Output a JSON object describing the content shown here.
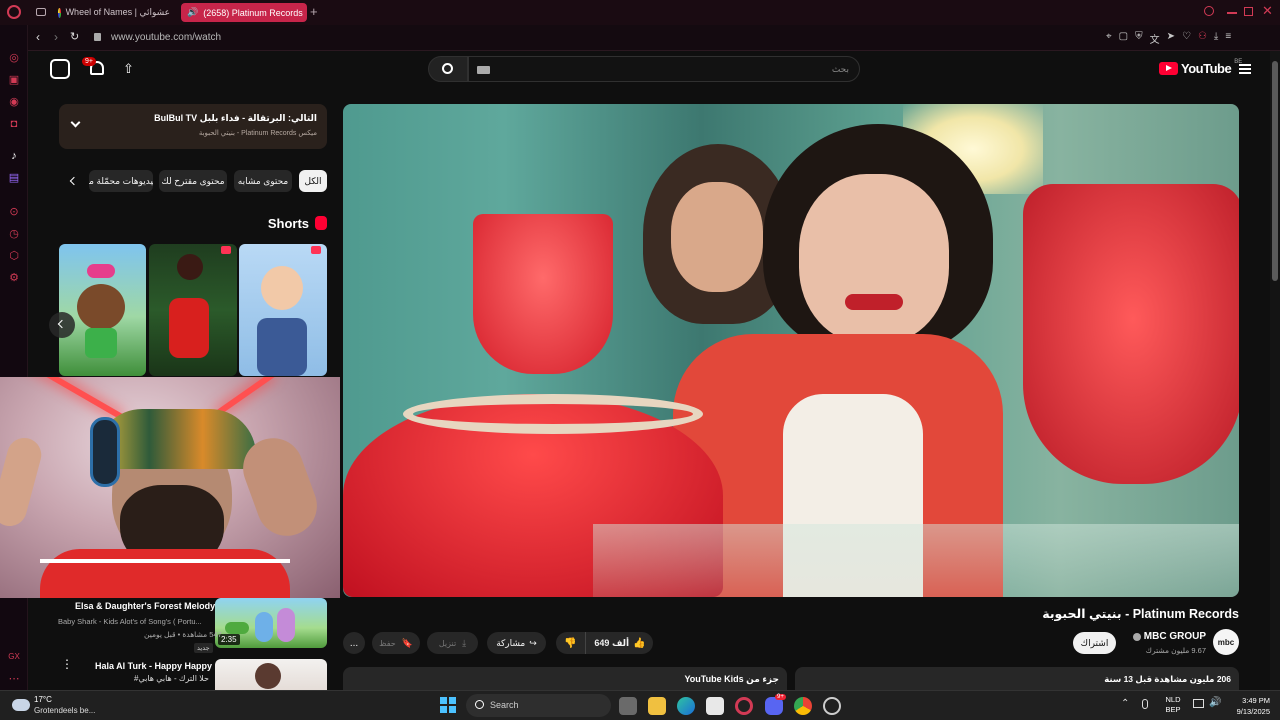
{
  "browser": {
    "tabs": [
      {
        "label": "Wheel of Names | عشوائي",
        "active": false
      },
      {
        "label": "(2658) Platinum Records",
        "active": true
      }
    ],
    "new_tab": "+",
    "url": "www.youtube.com/watch"
  },
  "youtube": {
    "logo_text": "YouTube",
    "logo_region": "BE",
    "notif_badge": "9+",
    "search_placeholder": "بحث",
    "now_playing": {
      "title": "التالي: البرتقالة - فداء بلبل BulBul TV",
      "subtitle": "ميكس Platinum Records - بنيتي الحبوبة"
    },
    "chips": [
      "الكل",
      "محتوى مشابه",
      "محتوى مقترح لك",
      "فيديوهات محمّلة مؤ"
    ],
    "shorts_title": "Shorts",
    "video": {
      "title": "بنيتي الحبوبة - Platinum Records",
      "channel": "MBC GROUP",
      "subscribers": "9.67 مليون مشترك",
      "subscribe_label": "اشتراك",
      "channel_avatar_text": "mbc",
      "likes": "649 ألف",
      "share_label": "مشاركة",
      "download_label": "تنزيل",
      "save_label": "حفظ",
      "more_label": "...",
      "views_label": "206 مليون مشاهدة قبل 13 سنة",
      "kids_label": "جزء من YouTube Kids"
    },
    "recommendations": [
      {
        "title": "Elsa & Daughter's Forest Melody",
        "channel": "Baby Shark - Kids Alot's of Song's ( Portu...",
        "meta": "547 مشاهدة • قبل يومين",
        "badge": "جديد",
        "duration": "2:35"
      },
      {
        "title": "Hala Al Turk - Happy Happy",
        "subtitle": "حلا الترك - هابي هابي#",
        "duration": ""
      }
    ]
  },
  "taskbar": {
    "weather_temp": "17°C",
    "weather_desc": "Grotendeels be...",
    "search_label": "Search",
    "lang_top": "NLD",
    "lang_bottom": "BEP",
    "time": "3:49 PM",
    "date": "9/13/2025",
    "discord_badge": "9+"
  },
  "colors": {
    "opera_red": "#d23a55",
    "youtube_red": "#ff0033",
    "background": "#0f0f0f"
  }
}
